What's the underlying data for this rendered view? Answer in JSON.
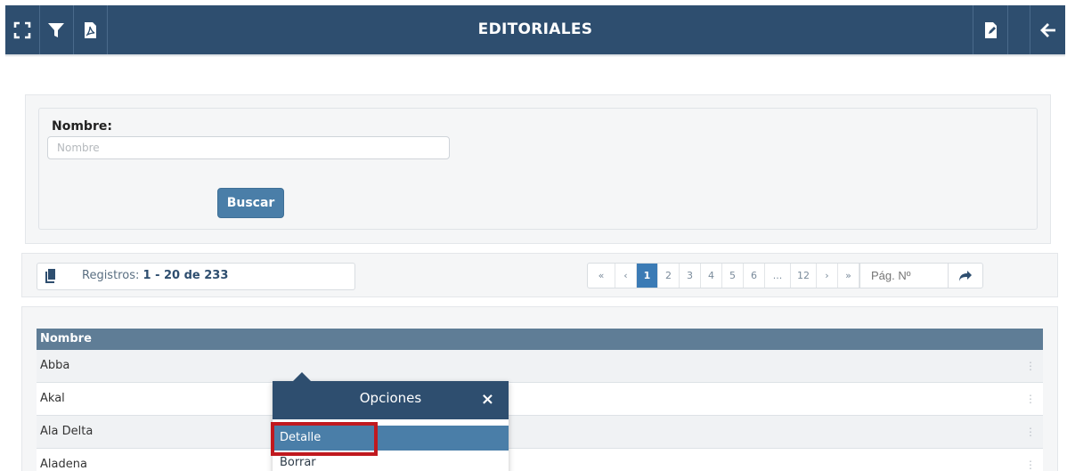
{
  "header": {
    "title": "EDITORIALES",
    "icons": [
      "expand-icon",
      "filter-icon",
      "pdf-icon",
      "edit-document-icon",
      "arrow-left-icon"
    ]
  },
  "search": {
    "label": "Nombre:",
    "placeholder": "Nombre",
    "value": "",
    "button": "Buscar"
  },
  "records": {
    "prefix": "Registros:",
    "range": "1 - 20 de 233"
  },
  "pager": {
    "first": "«",
    "prev": "‹",
    "pages": [
      "1",
      "2",
      "3",
      "4",
      "5",
      "6",
      "...",
      "12"
    ],
    "active": "1",
    "next": "›",
    "last": "»",
    "page_input_placeholder": "Pág. Nº"
  },
  "table": {
    "column": "Nombre",
    "rows": [
      "Abba",
      "Akal",
      "Ala Delta",
      "Aladena"
    ]
  },
  "popup": {
    "title": "Opciones",
    "close": "×",
    "items": [
      "Detalle",
      "Borrar"
    ]
  },
  "colors": {
    "topbar": "#2e4e6f",
    "button": "#4a7ea8",
    "grid_header": "#5f7d96",
    "highlight": "#c0191f",
    "active_page": "#3b7bb5"
  }
}
